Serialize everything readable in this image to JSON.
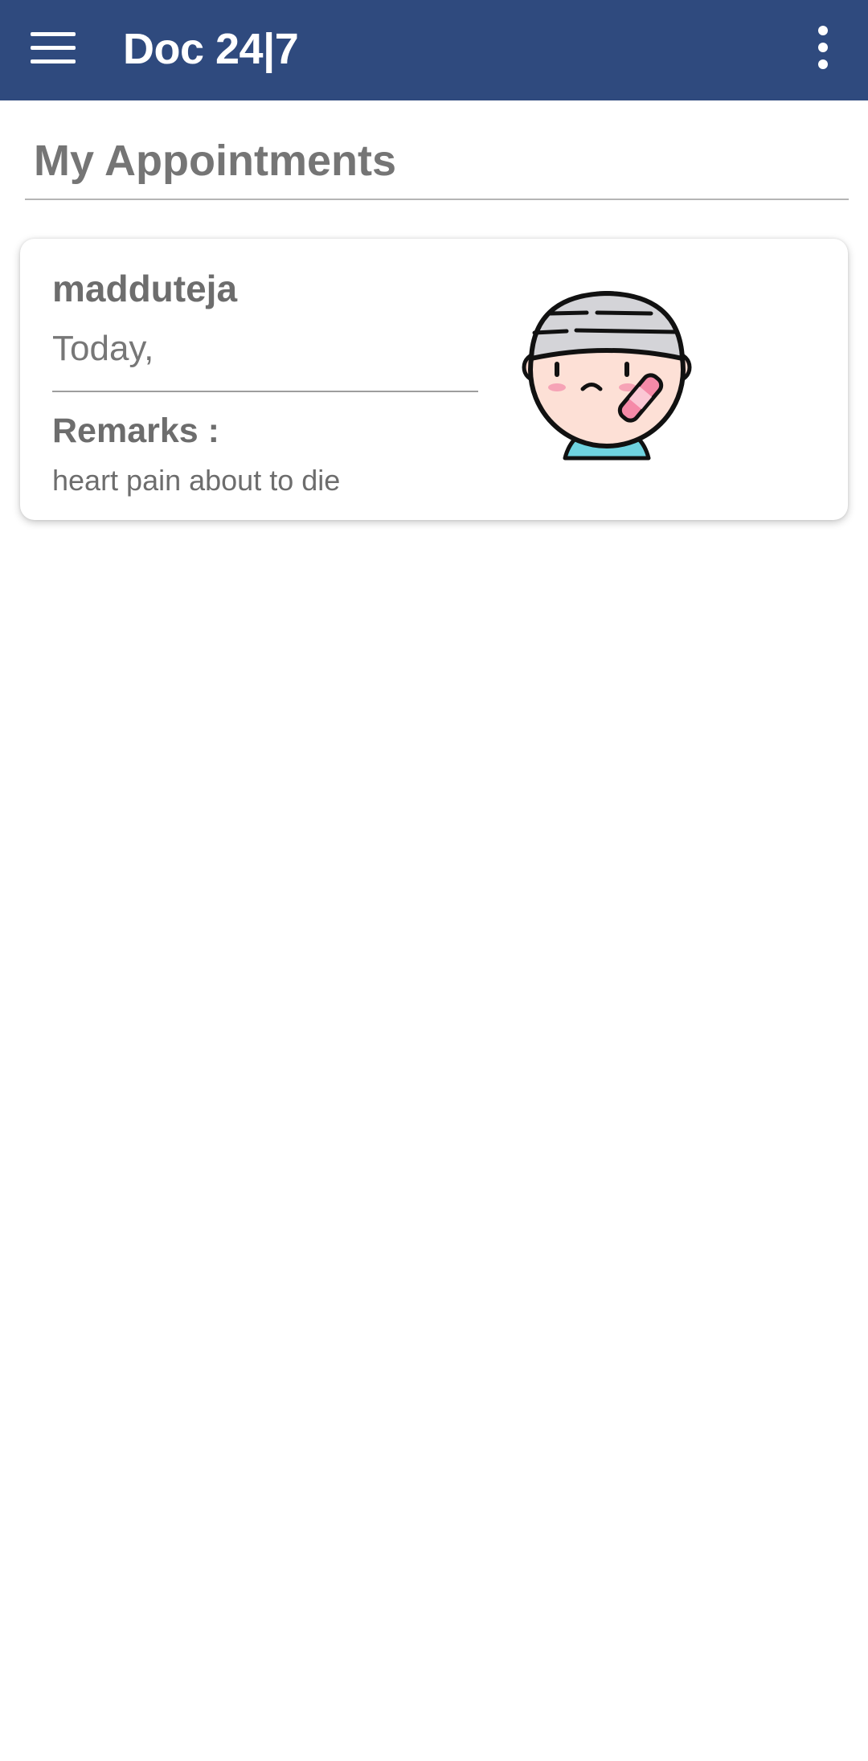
{
  "app_bar": {
    "title": "Doc 24|7",
    "menu_icon": "hamburger-menu-icon",
    "overflow_icon": "more-vert-icon",
    "background_color": "#2f4a7e"
  },
  "page": {
    "section_title": "My Appointments"
  },
  "appointments": [
    {
      "patient_name": "madduteja",
      "date": "Today,",
      "remarks_label": "Remarks :",
      "remarks": "heart pain about to die",
      "avatar_icon": "sick-boy-avatar-icon"
    }
  ]
}
